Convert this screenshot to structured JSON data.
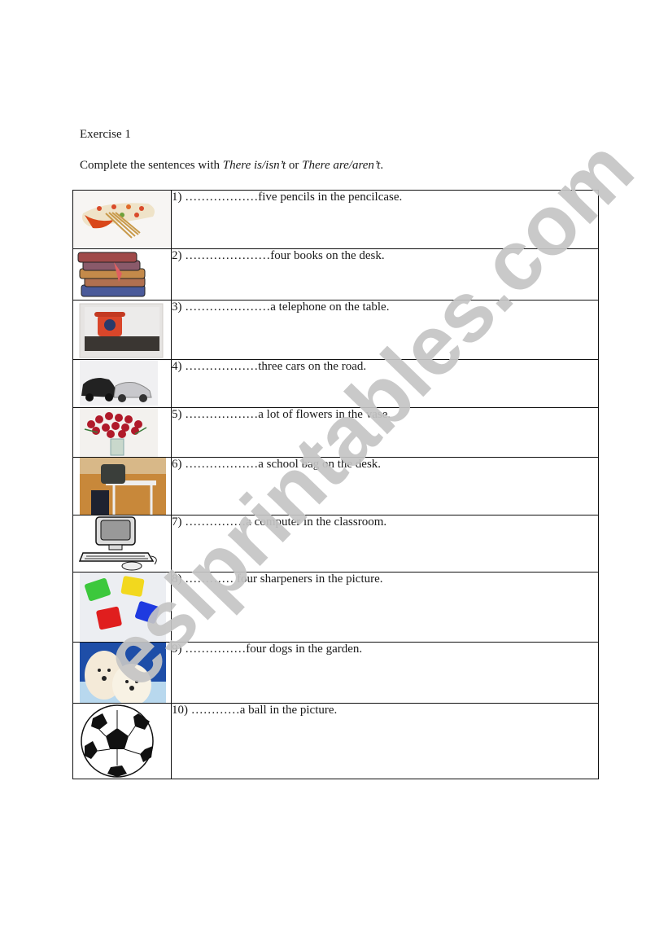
{
  "heading": "Exercise 1",
  "instruction": {
    "prefix": "Complete the sentences with ",
    "option1": "There is/isn’t",
    "joiner": " or ",
    "option2": "There are/aren’t",
    "suffix": "."
  },
  "items": [
    {
      "number": "1)",
      "blank": "………………",
      "rest": "five pencils in the pencilcase.",
      "picture": "pencilcase-picture"
    },
    {
      "number": "2)",
      "blank": "…………………",
      "rest": "four books on the desk.",
      "picture": "books-picture"
    },
    {
      "number": "3)",
      "blank": "…………………",
      "rest": "a telephone on the table.",
      "picture": "telephone-picture"
    },
    {
      "number": "4)",
      "blank": "………………",
      "rest": "three cars on the road.",
      "picture": "cars-picture"
    },
    {
      "number": "5)",
      "blank": "………………",
      "rest": "a lot of flowers in the vase.",
      "picture": "flowers-picture"
    },
    {
      "number": "6)",
      "blank": "………………",
      "rest": "a school bag on the desk.",
      "picture": "school-bag-picture"
    },
    {
      "number": "7)",
      "blank": "……………",
      "rest": "a computer in the classroom.",
      "picture": "computer-picture"
    },
    {
      "number": "8)",
      "blank": "………… ",
      "rest": "four sharpeners in the picture.",
      "picture": "sharpeners-picture"
    },
    {
      "number": "9)",
      "blank": "……………",
      "rest": "four dogs in the garden.",
      "picture": "dogs-picture"
    },
    {
      "number": "10)",
      "blank": "…………",
      "rest": "a ball in the picture.",
      "picture": "soccer-ball-picture"
    }
  ],
  "watermark": "eslprintables.com",
  "colors": {
    "watermark": "#c4c4c4",
    "border": "#111111"
  }
}
